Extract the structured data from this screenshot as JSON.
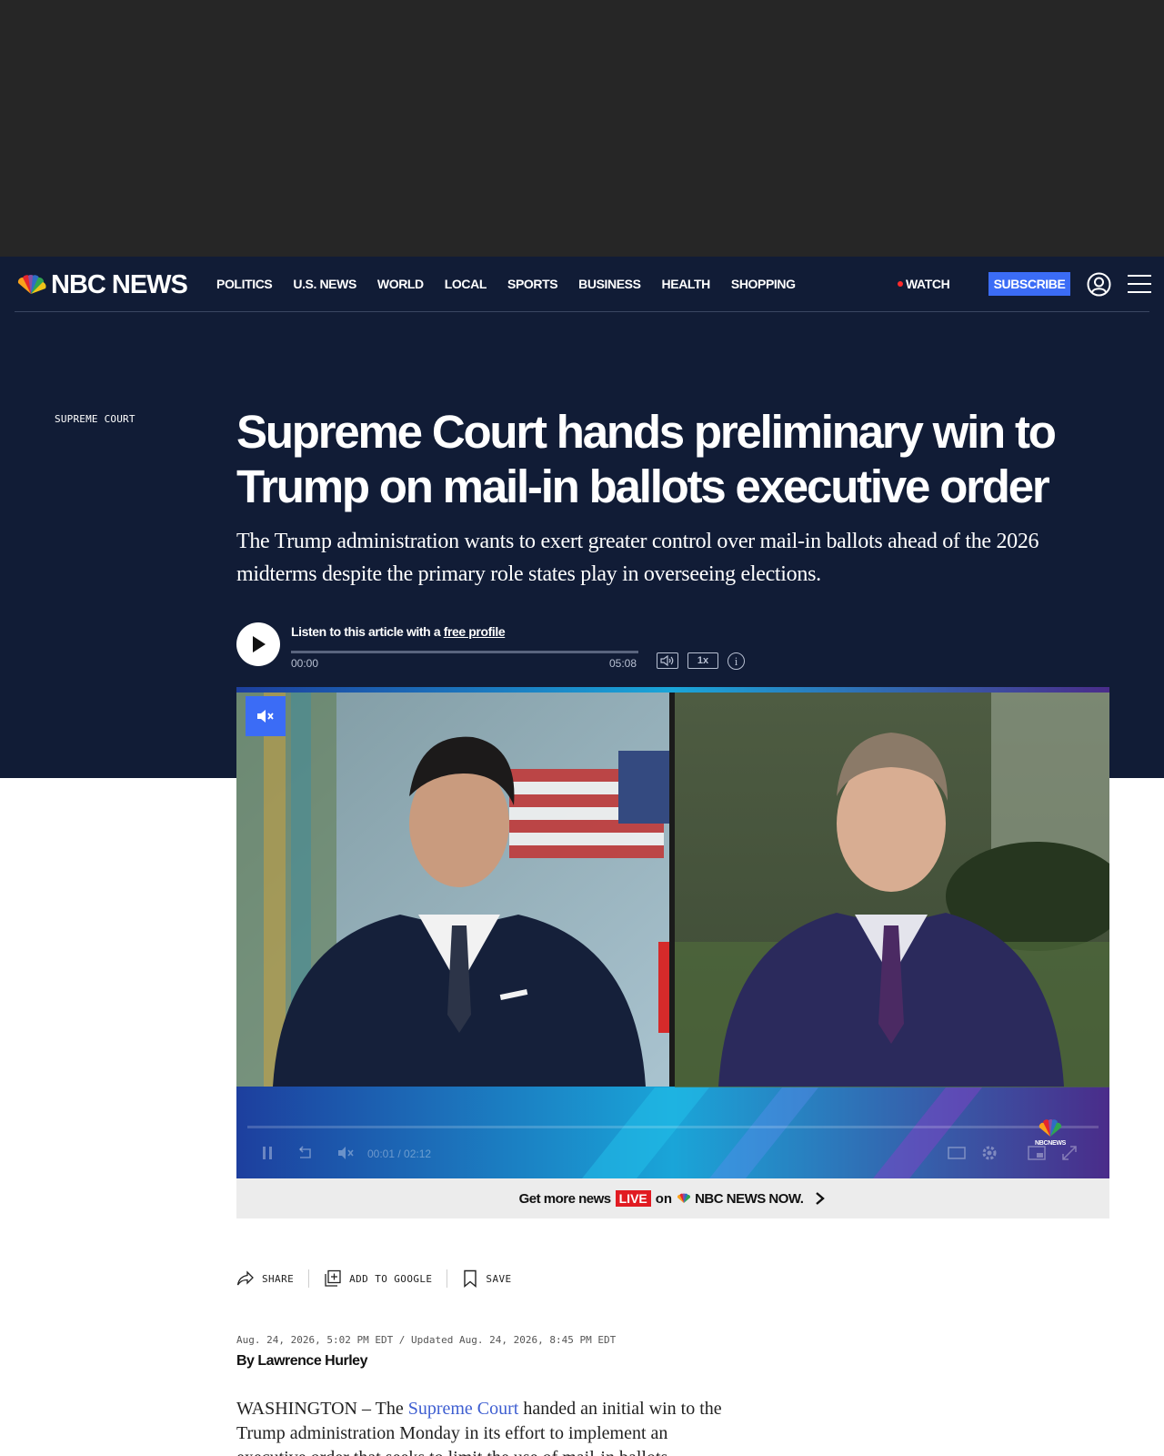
{
  "site": {
    "brand": "NBC NEWS"
  },
  "nav": {
    "links": [
      "POLITICS",
      "U.S. NEWS",
      "WORLD",
      "LOCAL",
      "SPORTS",
      "BUSINESS",
      "HEALTH",
      "SHOPPING"
    ],
    "watch_label": "WATCH",
    "subscribe_label": "SUBSCRIBE"
  },
  "article": {
    "section": "SUPREME COURT",
    "headline": "Supreme Court hands preliminary win to Trump on mail-in ballots executive order",
    "dek": "The Trump administration wants to exert greater control over mail-in ballots ahead of the 2026 midterms despite the primary role states play in overseeing elections.",
    "timestamp": "Aug. 24, 2026, 5:02 PM EDT / Updated Aug. 24, 2026, 8:45 PM EDT",
    "byline_prefix": "By ",
    "author": "Lawrence Hurley",
    "body_before": "WASHINGTON – The ",
    "body_link": "Supreme Court",
    "body_after": " handed an initial win to the Trump administration Monday in its effort to implement an executive order that seeks to limit the use of mail-in ballots"
  },
  "audio": {
    "listen_prefix": "Listen to this article with a ",
    "listen_link": "free profile",
    "current_time": "00:00",
    "duration": "05:08",
    "speed": "1x",
    "info": "i"
  },
  "video": {
    "time_display": "00:01 / 02:12",
    "watermark": "NBCNEWS"
  },
  "live_promo": {
    "prefix": "Get more news",
    "badge": "LIVE",
    "on": "on",
    "brand": "NBC NEWS NOW."
  },
  "tools": {
    "share": "SHARE",
    "add_google": "ADD TO GOOGLE",
    "save": "SAVE"
  },
  "colors": {
    "hero_bg": "#111c36",
    "ad_bg": "#262626",
    "accent_blue": "#3b6cf6",
    "live_red": "#e11b22",
    "link_blue": "#3f5fd1"
  }
}
